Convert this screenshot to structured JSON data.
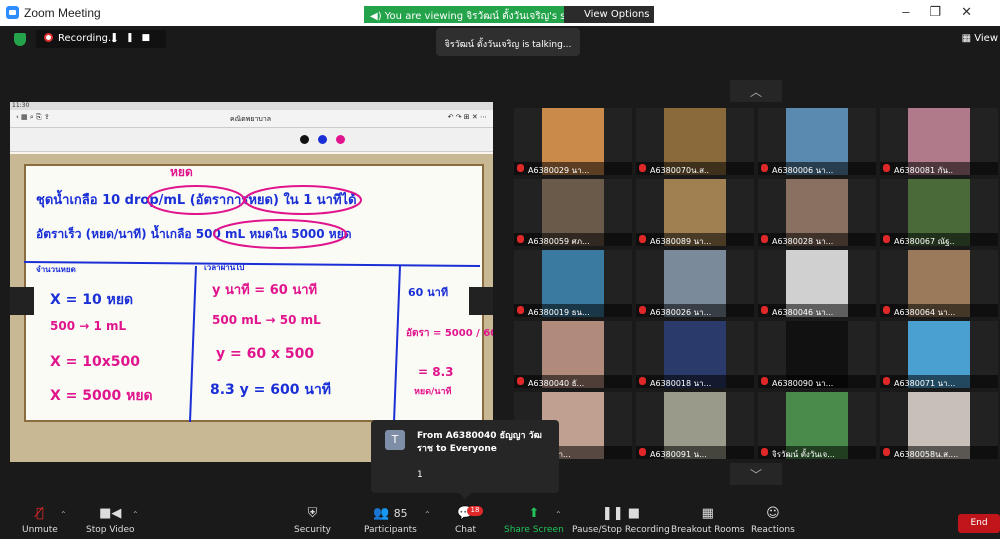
{
  "window": {
    "title": "Zoom Meeting"
  },
  "banner": {
    "viewing": "You are viewing จิรวัฒน์ ตั้งวันเจริญ's screen",
    "view_options": "View Options"
  },
  "talking": "จิรวัฒน์ ตั้งวันเจริญ is talking...",
  "recording": {
    "label": "Recording..."
  },
  "view_button": "View",
  "shared": {
    "status_time": "11:30",
    "doc_title": "คณิตพยาบาล",
    "pen_colors": [
      "#111111",
      "#1a2fd6",
      "#e0148c"
    ],
    "board_text": {
      "l1": "ชุดน้ำเกลือ 10 drop/mL (อัตราการหยด) ใน 1 นาทีได้",
      "l2": "อัตราเร็ว (หยด/นาที) น้ำเกลือ 500 mL หมดใน 5000 หยด",
      "hyd": "หยด",
      "sec1": "จำนวนหยด",
      "sec2": "เวลาผ่านไป",
      "a1": "X = 10 หยด",
      "a2": "500 → 1 mL",
      "a3": "X = 10x500",
      "a4": "X = 5000 หยด",
      "b1": "y นาที = 60 นาที",
      "b2": "500 mL → 50 mL",
      "b3": "y = 60 x 500",
      "b4": "8.3 y = 600 นาที",
      "c1": "60 นาที",
      "c2": "อัตรา = 5000 / 600",
      "c3": "= 8.3",
      "c4": "หยด/นาที"
    }
  },
  "participants": [
    {
      "name": "A6380029 นา..."
    },
    {
      "name": "A6380070น.ส.."
    },
    {
      "name": "A6380006 นา..."
    },
    {
      "name": "A6380081 กัน.."
    },
    {
      "name": "A6380059 ศภ..."
    },
    {
      "name": "A6380089 นา..."
    },
    {
      "name": "A6380028 นา..."
    },
    {
      "name": "A6380067 ณัฐ.."
    },
    {
      "name": "A6380019 ธน..."
    },
    {
      "name": "A6380026 นา..."
    },
    {
      "name": "A6380046 นา..."
    },
    {
      "name": "A6380064 นา..."
    },
    {
      "name": "A6380040 ธั..."
    },
    {
      "name": "A6380018 นา..."
    },
    {
      "name": "A6380090 นา..."
    },
    {
      "name": "A6380071 นา..."
    },
    {
      "name": "...082 ปา..."
    },
    {
      "name": "A6380091 น..."
    },
    {
      "name": "จิรวัฒน์ ตั้งวันเจ..."
    },
    {
      "name": "A6380058น.ส...."
    }
  ],
  "chat_popup": {
    "avatar": "T",
    "from": "From A6380040 ธัญญา วัฒ ราช to Everyone",
    "message": "1"
  },
  "toolbar": {
    "unmute": "Unmute",
    "stop_video": "Stop Video",
    "security": "Security",
    "participants": "Participants",
    "participants_count": "85",
    "chat": "Chat",
    "chat_badge": "18",
    "share_screen": "Share Screen",
    "pause_recording": "Pause/Stop Recording",
    "breakout": "Breakout Rooms",
    "reactions": "Reactions",
    "end": "End"
  },
  "colors": {
    "green": "#23a34a",
    "end_red": "#c0161b",
    "pink_ink": "#e0148c",
    "blue_ink": "#1a2fd6"
  }
}
